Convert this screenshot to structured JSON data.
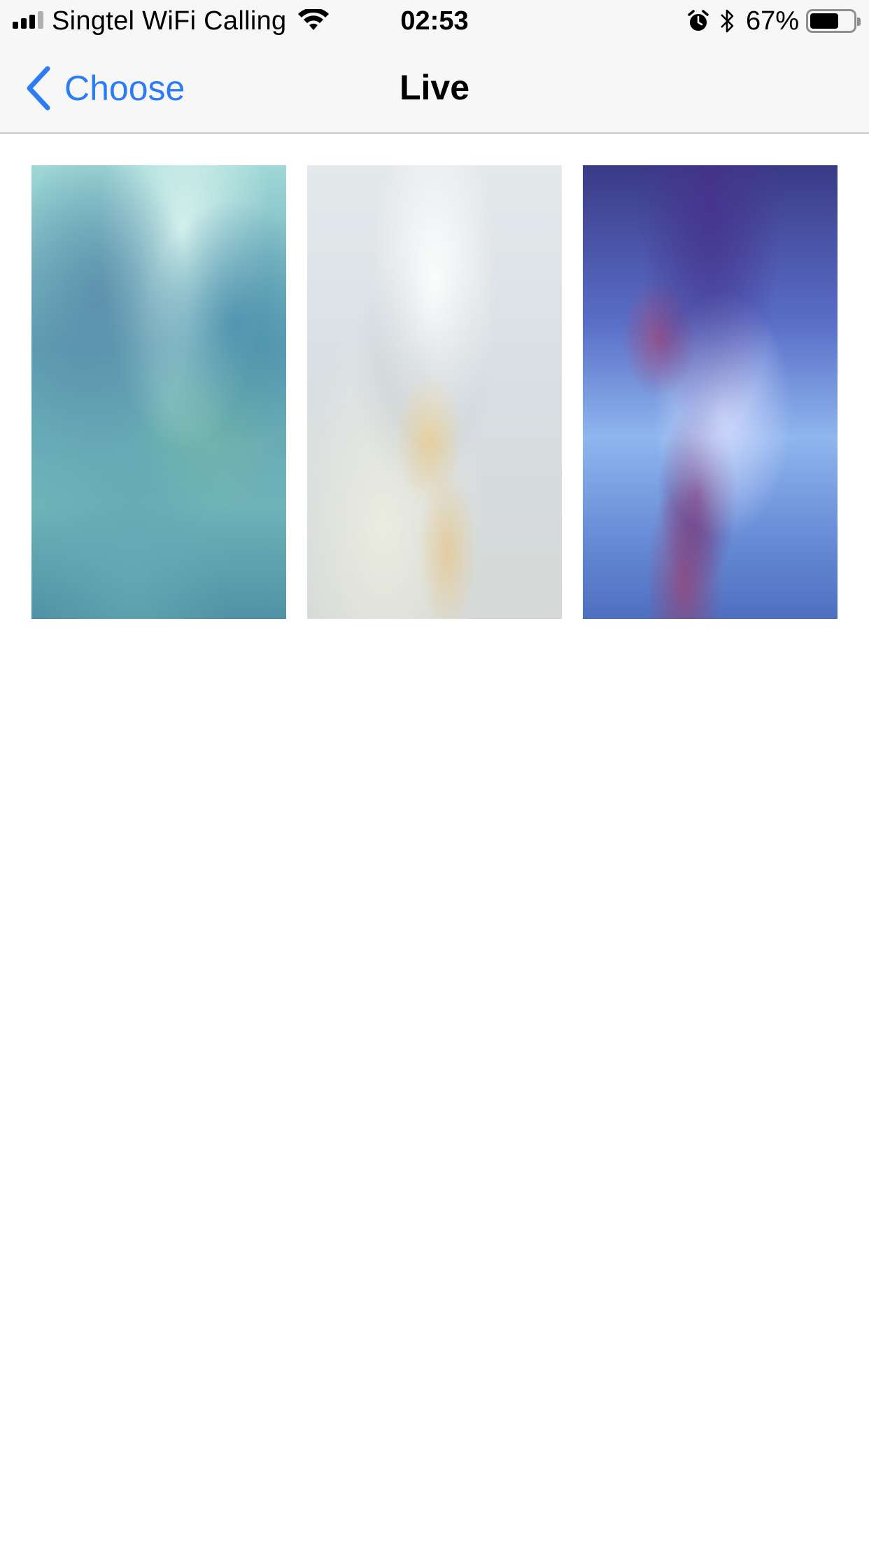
{
  "status_bar": {
    "carrier": "Singtel WiFi Calling",
    "time": "02:53",
    "battery_percent": "67%",
    "battery_level": 0.67,
    "signal_bars_filled": 3,
    "signal_bars_total": 4,
    "icons": [
      "signal-icon",
      "wifi-icon",
      "alarm-icon",
      "bluetooth-icon",
      "battery-icon"
    ]
  },
  "nav": {
    "back_label": "Choose",
    "title": "Live",
    "accent_color": "#2d7cf6"
  },
  "wallpapers": [
    {
      "name": "teal-smoke",
      "dominant_color": "#6fb3b9"
    },
    {
      "name": "white-smoke",
      "dominant_color": "#dde2e4"
    },
    {
      "name": "purple-blue-smoke",
      "dominant_color": "#6b8fd8"
    }
  ]
}
